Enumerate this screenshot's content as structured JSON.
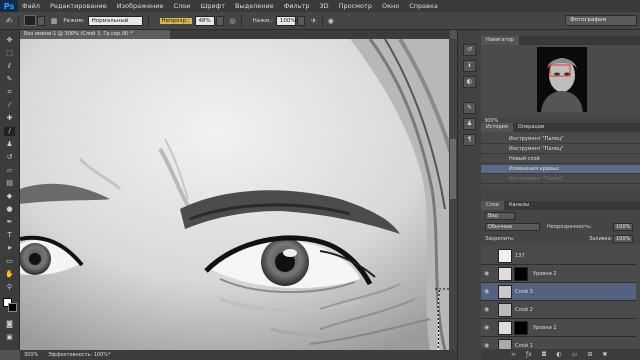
{
  "app": {
    "logo": "Ps"
  },
  "menu": [
    "Файл",
    "Редактирование",
    "Изображение",
    "Слои",
    "Шрифт",
    "Выделение",
    "Фильтр",
    "3D",
    "Просмотр",
    "Окно",
    "Справка"
  ],
  "options": {
    "mode_label": "Режим:",
    "mode_value": "Нормальный",
    "opacity_label": "Непрозр.:",
    "opacity_value": "48%",
    "flow_label": "Нажм.:",
    "flow_value": "100%",
    "workspace": "Фотография"
  },
  "document": {
    "tab_title": "Без имени-1 @ 300% (Слой 3, Гр.сер./8) *"
  },
  "status": {
    "zoom": "300%",
    "info": "Эффективность: 100%*"
  },
  "navigator": {
    "title": "Навигатор",
    "zoom": "300%"
  },
  "history": {
    "tabs": [
      "История",
      "Операции"
    ],
    "rows": [
      {
        "label": "Инструмент \"Палец\"",
        "selected": false
      },
      {
        "label": "Инструмент \"Палец\"",
        "selected": false
      },
      {
        "label": "Новый слой",
        "selected": false
      },
      {
        "label": "Изменения кривых",
        "selected": true
      },
      {
        "label": "Инструмент \"Палец\"",
        "selected": false
      }
    ]
  },
  "layers": {
    "tabs": [
      "Слои",
      "Каналы"
    ],
    "kind_label": "Вид",
    "blend_mode": "Обычные",
    "opacity_label": "Непрозрачность:",
    "opacity_value": "100%",
    "lock_label": "Закрепить:",
    "fill_label": "Заливка:",
    "fill_value": "100%",
    "rows": [
      {
        "name": "137",
        "visible": false,
        "has_mask": false,
        "selected": false
      },
      {
        "name": "Уровни 2",
        "visible": true,
        "has_mask": true,
        "selected": false
      },
      {
        "name": "Слой 3",
        "visible": true,
        "has_mask": false,
        "selected": true
      },
      {
        "name": "Слой 2",
        "visible": true,
        "has_mask": false,
        "selected": false
      },
      {
        "name": "Уровни 1",
        "visible": true,
        "has_mask": true,
        "selected": false
      },
      {
        "name": "Слой 1",
        "visible": true,
        "has_mask": false,
        "selected": false
      }
    ]
  },
  "colors": {
    "panel_bg": "#454545",
    "selection": "#55627f",
    "menubar": "#3a3a3a"
  },
  "toolbox": [
    "move-icon",
    "marquee-icon",
    "lasso-icon",
    "quick-select-icon",
    "crop-icon",
    "eyedropper-icon",
    "healing-icon",
    "brush-icon",
    "stamp-icon",
    "history-brush-icon",
    "eraser-icon",
    "gradient-icon",
    "blur-icon",
    "dodge-icon",
    "pen-icon",
    "type-icon",
    "path-select-icon",
    "shape-icon",
    "hand-icon",
    "zoom-icon"
  ]
}
